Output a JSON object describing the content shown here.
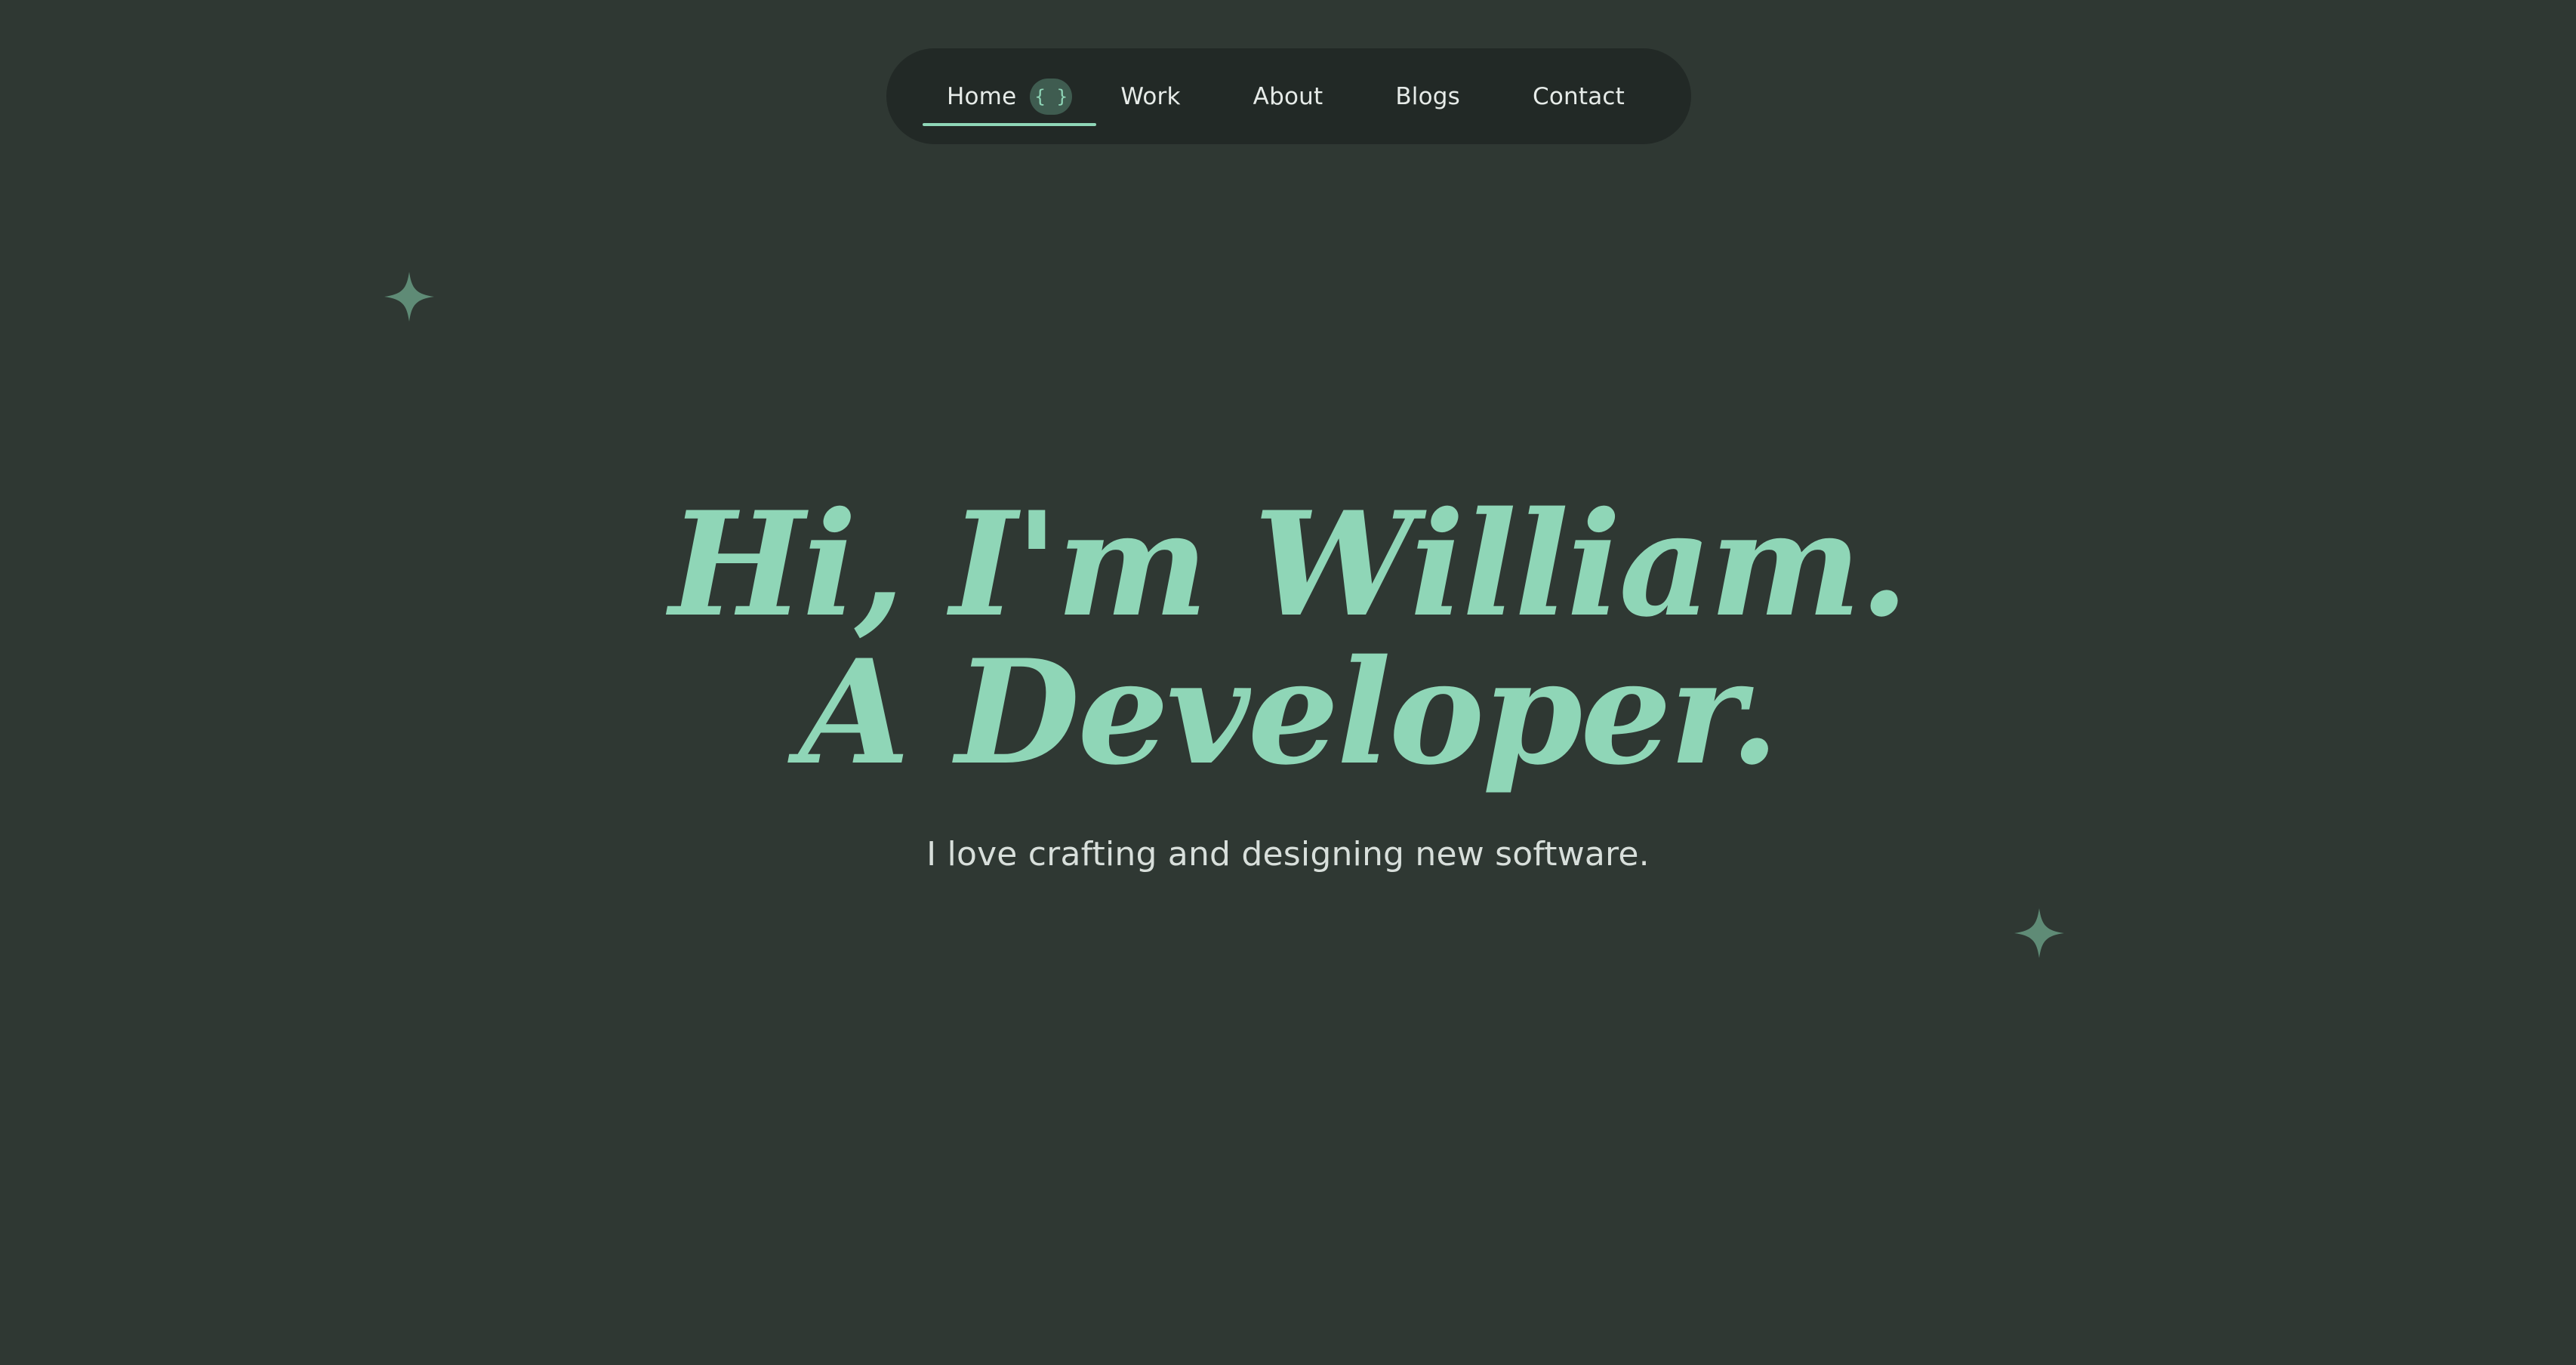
{
  "nav": {
    "items": [
      {
        "label": "Home",
        "badge": "{ }"
      },
      {
        "label": "Work"
      },
      {
        "label": "About"
      },
      {
        "label": "Blogs"
      },
      {
        "label": "Contact"
      }
    ],
    "active": "Home"
  },
  "hero": {
    "headline_line1": "Hi, I'm William.",
    "headline_line2": "A Developer.",
    "subtitle": "I love crafting and designing new software."
  },
  "decor": {
    "sparkle_icon": "four-point-star-icon"
  },
  "colors": {
    "background": "#2f3833",
    "nav_background": "#222926",
    "accent": "#8fd6b7",
    "sparkle": "#5f8b76",
    "text": "#e6ebe8"
  }
}
